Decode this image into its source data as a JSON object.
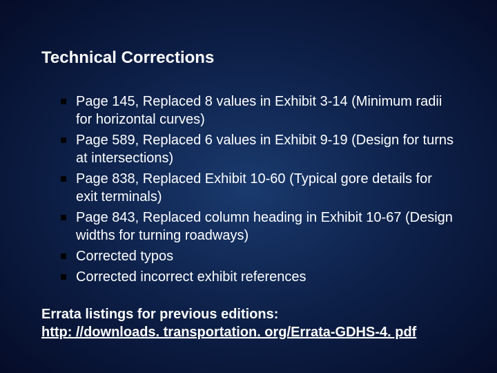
{
  "title": "Technical Corrections",
  "items": [
    "Page 145, Replaced 8 values in Exhibit 3-14 (Minimum radii for horizontal curves)",
    "Page 589, Replaced 6 values in Exhibit 9-19 (Design for turns at intersections)",
    "Page 838, Replaced Exhibit 10-60 (Typical gore details for exit terminals)",
    "Page 843, Replaced column heading in Exhibit 10-67 (Design widths for turning roadways)",
    "Corrected typos",
    "Corrected incorrect exhibit references"
  ],
  "footer_label": "Errata listings for previous editions:",
  "footer_link": "http: //downloads. transportation. org/Errata-GDHS-4. pdf"
}
